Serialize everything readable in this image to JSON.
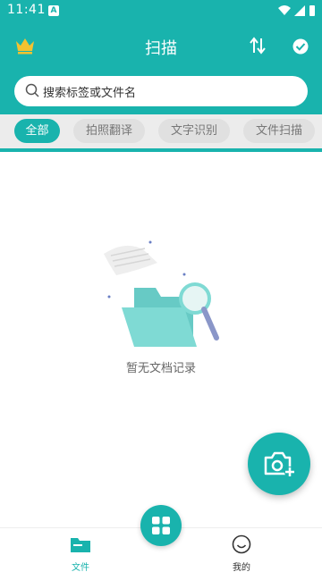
{
  "status_bar": {
    "time": "11:41",
    "notification": "A"
  },
  "header": {
    "title": "扫描"
  },
  "search": {
    "placeholder": "搜索标签或文件名"
  },
  "tabs": [
    {
      "label": "全部",
      "active": true
    },
    {
      "label": "拍照翻译",
      "active": false
    },
    {
      "label": "文字识别",
      "active": false
    },
    {
      "label": "文件扫描",
      "active": false
    }
  ],
  "empty_state": {
    "message": "暂无文档记录"
  },
  "bottom_nav": {
    "items": [
      {
        "label": "文件",
        "active": true
      },
      {
        "label": "我的",
        "active": false
      }
    ]
  },
  "colors": {
    "accent": "#19b3ad",
    "crown": "#f2c230",
    "tab_bg": "#e0e0e0"
  },
  "icons": [
    "crown-icon",
    "sort-icon",
    "check-circle-icon",
    "search-icon",
    "camera-add-icon",
    "grid-icon",
    "folder-icon",
    "smile-icon"
  ]
}
